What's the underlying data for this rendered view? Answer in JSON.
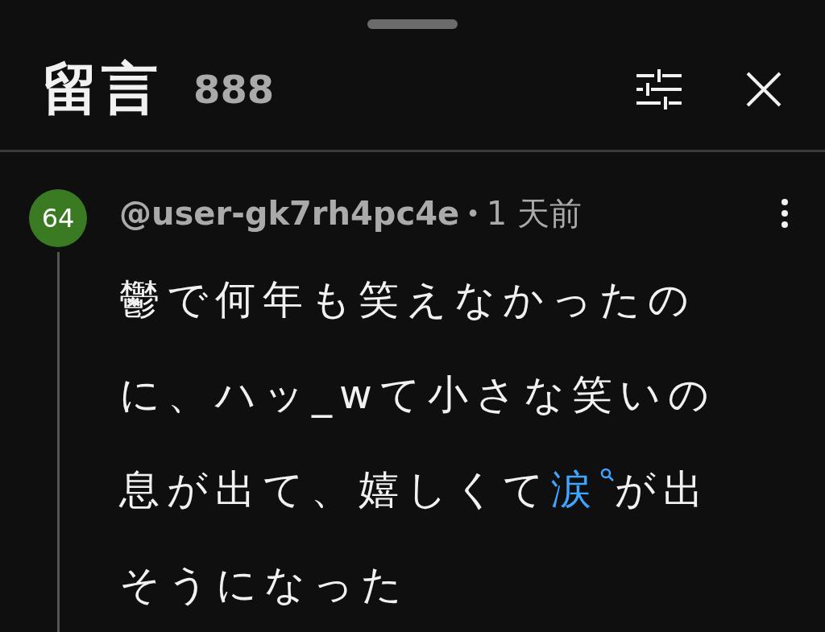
{
  "header": {
    "title": "留言",
    "count": "888"
  },
  "comment": {
    "avatar_text": "64",
    "color": "#3a7a22",
    "author": "@user-gk7rh4pc4e",
    "separator": "•",
    "time": "1 天前",
    "parts": [
      {
        "kind": "text",
        "text": "鬱で何年も笑えなかったのに、ハッ_wて小さな笑いの息が出て、嬉しくて"
      },
      {
        "kind": "link",
        "text": "涙"
      },
      {
        "kind": "text",
        "text": "が出そうになった"
      }
    ]
  }
}
